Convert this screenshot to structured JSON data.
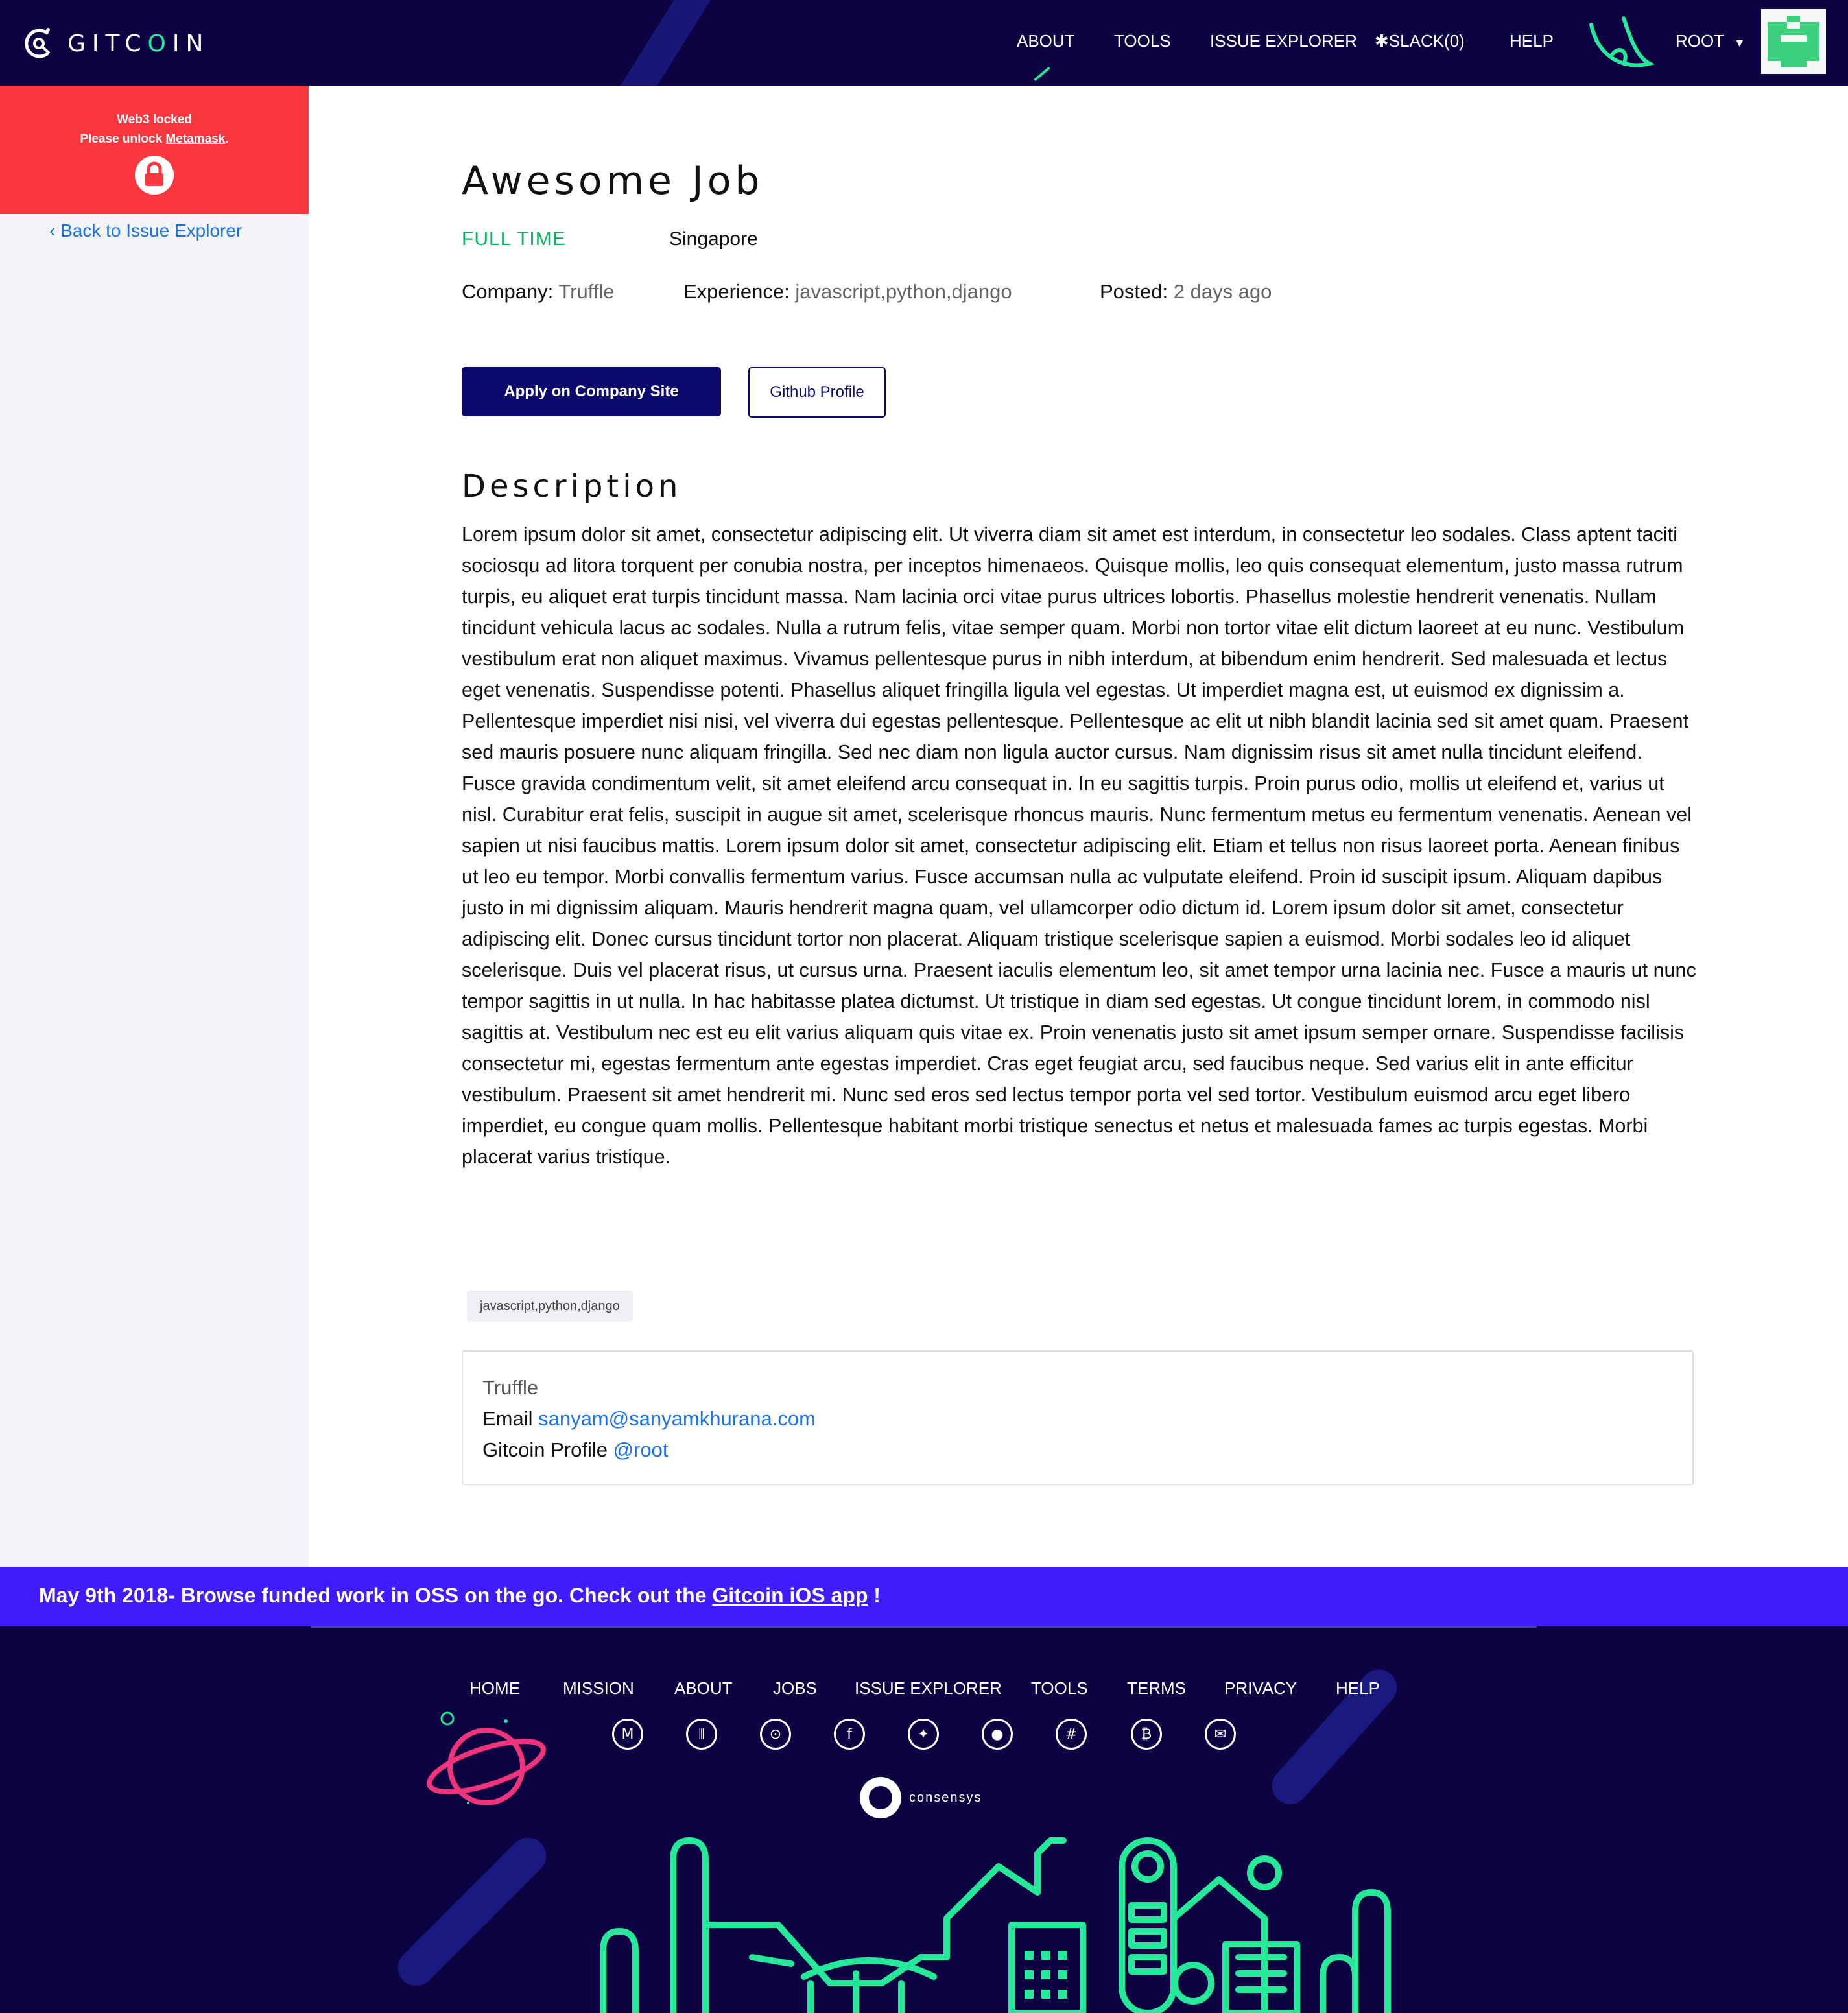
{
  "navbar": {
    "logo_text_1": "GITC",
    "logo_text_o": "O",
    "logo_text_2": "IN",
    "items": {
      "about": "ABOUT",
      "tools": "TOOLS",
      "issue_explorer": "ISSUE EXPLORER",
      "slack": "SLACK(0)",
      "help": "HELP",
      "user": "ROOT"
    }
  },
  "sidebar": {
    "web3_title": "Web3 locked",
    "web3_sub_prefix": "Please unlock ",
    "web3_sub_link": "Metamask",
    "web3_sub_suffix": ".",
    "back_link": "Back to Issue Explorer"
  },
  "job": {
    "title": "Awesome Job",
    "type": "FULL TIME",
    "location": "Singapore",
    "company_label": "Company: ",
    "company": "Truffle",
    "experience_label": "Experience: ",
    "experience": "javascript,python,django",
    "posted_label": "Posted: ",
    "posted": "2 days ago",
    "apply_button": "Apply on Company Site",
    "github_button": "Github Profile",
    "description_heading": "Description",
    "description": "Lorem ipsum dolor sit amet, consectetur adipiscing elit. Ut viverra diam sit amet est interdum, in consectetur leo sodales. Class aptent taciti sociosqu ad litora torquent per conubia nostra, per inceptos himenaeos. Quisque mollis, leo quis consequat elementum, justo massa rutrum turpis, eu aliquet erat turpis tincidunt massa. Nam lacinia orci vitae purus ultrices lobortis. Phasellus molestie hendrerit venenatis. Nullam tincidunt vehicula lacus ac sodales. Nulla a rutrum felis, vitae semper quam. Morbi non tortor vitae elit dictum laoreet at eu nunc. Vestibulum vestibulum erat non aliquet maximus. Vivamus pellentesque purus in nibh interdum, at bibendum enim hendrerit. Sed malesuada et lectus eget venenatis. Suspendisse potenti. Phasellus aliquet fringilla ligula vel egestas. Ut imperdiet magna est, ut euismod ex dignissim a. Pellentesque imperdiet nisi nisi, vel viverra dui egestas pellentesque. Pellentesque ac elit ut nibh blandit lacinia sed sit amet quam. Praesent sed mauris posuere nunc aliquam fringilla. Sed nec diam non ligula auctor cursus. Nam dignissim risus sit amet nulla tincidunt eleifend. Fusce gravida condimentum velit, sit amet eleifend arcu consequat in. In eu sagittis turpis. Proin purus odio, mollis ut eleifend et, varius ut nisl. Curabitur erat felis, suscipit in augue sit amet, scelerisque rhoncus mauris. Nunc fermentum metus eu fermentum venenatis. Aenean vel sapien ut nisi faucibus mattis. Lorem ipsum dolor sit amet, consectetur adipiscing elit. Etiam et tellus non risus laoreet porta. Aenean finibus ut leo eu tempor. Morbi convallis fermentum varius. Fusce accumsan nulla ac vulputate eleifend. Proin id suscipit ipsum. Aliquam dapibus justo in mi dignissim aliquam. Mauris hendrerit magna quam, vel ullamcorper odio dictum id. Lorem ipsum dolor sit amet, consectetur adipiscing elit. Donec cursus tincidunt tortor non placerat. Aliquam tristique scelerisque sapien a euismod. Morbi sodales leo id aliquet scelerisque. Duis vel placerat risus, ut cursus urna. Praesent iaculis elementum leo, sit amet tempor urna lacinia nec. Fusce a mauris ut nunc tempor sagittis in ut nulla. In hac habitasse platea dictumst. Ut tristique in diam sed egestas. Ut congue tincidunt lorem, in commodo nisl sagittis at. Vestibulum nec est eu elit varius aliquam quis vitae ex. Proin venenatis justo sit amet ipsum semper ornare. Suspendisse facilisis consectetur mi, egestas fermentum ante egestas imperdiet. Cras eget feugiat arcu, sed faucibus neque. Sed varius elit in ante efficitur vestibulum. Praesent sit amet hendrerit mi. Nunc sed eros sed lectus tempor porta vel sed tortor. Vestibulum euismod arcu eget libero imperdiet, eu congue quam mollis. Pellentesque habitant morbi tristique senectus et netus et malesuada fames ac turpis egestas. Morbi placerat varius tristique.",
    "tag": "javascript,python,django",
    "contact": {
      "company": "Truffle",
      "email_label": "Email ",
      "email": "sanyam@sanyamkhurana.com",
      "profile_label": "Gitcoin Profile ",
      "profile": "@root"
    }
  },
  "banner": {
    "text_prefix": "May 9th 2018- Browse funded work in OSS on the go. Check out the ",
    "link": "Gitcoin iOS app",
    "text_suffix": " !"
  },
  "footer": {
    "links": {
      "home": "HOME",
      "mission": "MISSION",
      "about": "ABOUT",
      "jobs": "JOBS",
      "issue_explorer": "ISSUE EXPLORER",
      "tools": "TOOLS",
      "terms": "TERMS",
      "privacy": "PRIVACY",
      "help": "HELP"
    },
    "social_icons": [
      "medium-icon",
      "gitter-icon",
      "github-icon",
      "facebook-icon",
      "twitter-icon",
      "reddit-icon",
      "slack-icon",
      "bitcoin-icon",
      "email-icon"
    ],
    "consensys": "consensys"
  },
  "colors": {
    "navy": "#0d0342",
    "accent_green": "#25e899",
    "web3_red": "#f9373e",
    "banner_purple": "#3e1cfb",
    "link_blue": "#1a73e8",
    "job_type_green": "#0fae64"
  }
}
